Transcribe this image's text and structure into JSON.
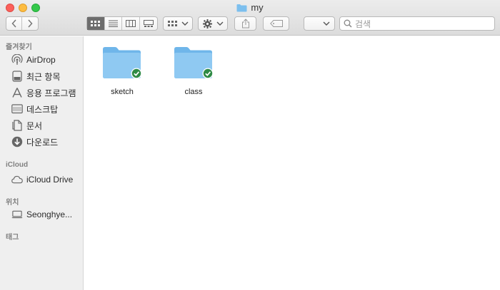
{
  "window": {
    "title": "my"
  },
  "toolbar": {
    "search_placeholder": "검색"
  },
  "sidebar": {
    "favorites_header": "즐겨찾기",
    "favorites": [
      {
        "label": "AirDrop",
        "icon": "airdrop-icon"
      },
      {
        "label": "최근 항목",
        "icon": "recents-icon"
      },
      {
        "label": "응용 프로그램",
        "icon": "applications-icon"
      },
      {
        "label": "데스크탑",
        "icon": "desktop-icon"
      },
      {
        "label": "문서",
        "icon": "documents-icon"
      },
      {
        "label": "다운로드",
        "icon": "downloads-icon"
      }
    ],
    "icloud_header": "iCloud",
    "icloud": [
      {
        "label": "iCloud Drive",
        "icon": "cloud-icon"
      }
    ],
    "locations_header": "위치",
    "locations": [
      {
        "label": "Seonghye...",
        "icon": "laptop-icon"
      }
    ],
    "tags_header": "태그"
  },
  "content": {
    "items": [
      {
        "name": "sketch",
        "icon": "folder-icon",
        "status": "synced"
      },
      {
        "name": "class",
        "icon": "folder-icon",
        "status": "synced"
      }
    ]
  },
  "colors": {
    "folder": "#8fc9f2",
    "sync_badge": "#2e8a45",
    "sidebar_bg": "#efefef"
  }
}
